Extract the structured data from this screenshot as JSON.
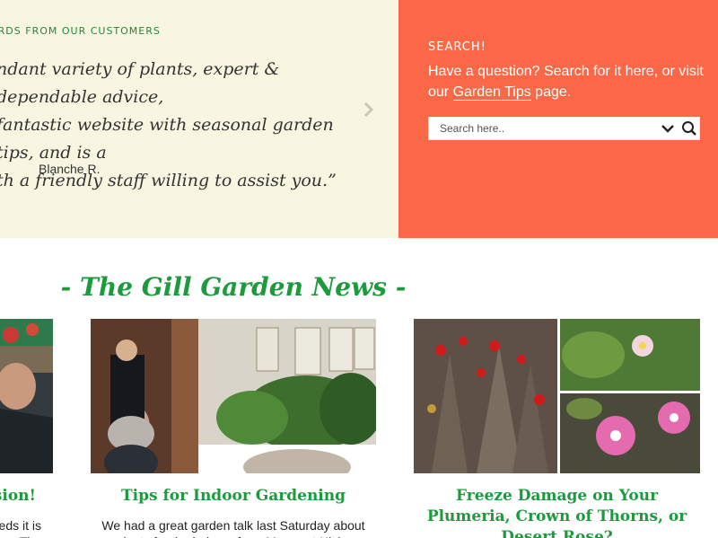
{
  "testimonials": {
    "heading": "ORDS FROM OUR CUSTOMERS",
    "quote": "ndant variety of plants, expert & dependable advice,\n fantastic website with seasonal garden tips, and is a\nth a friendly staff willing to assist you.”",
    "author": "Blanche R.",
    "next_icon": "chevron-right-icon"
  },
  "search": {
    "title": "SEARCH!",
    "desc_prefix": "Have a question? Search for it here, or visit our ",
    "desc_link": "Garden Tips",
    "desc_suffix": " page.",
    "placeholder": "Search here..",
    "dropdown_icon": "chevron-down-icon",
    "search_icon": "magnifier-icon"
  },
  "news": {
    "title": "- The Gill Garden News -",
    "cards": [
      {
        "title": "sion!",
        "text": "eds it is\nThe"
      },
      {
        "title": "Tips for Indoor Gardening",
        "text": "We had a great garden talk last Saturday about\nplants for the indoors from Margaret Hicks"
      },
      {
        "title": "Freeze Damage on Your Plumeria, Crown of Thorns, or Desert Rose?",
        "text": ""
      }
    ]
  },
  "colors": {
    "testimonial_bg": "#f8f6e0",
    "search_bg": "#fb6848",
    "accent_green": "#1e9a3e"
  }
}
